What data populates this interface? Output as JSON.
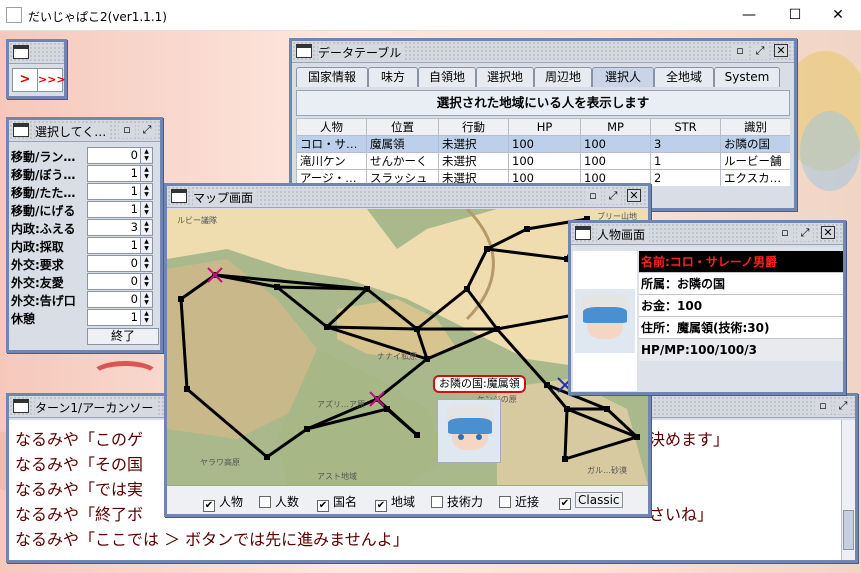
{
  "app": {
    "title": "だいじゃぱこ2(ver1.1.1)",
    "controls": {
      "minimize": "—",
      "maximize": "☐",
      "close": "✕"
    }
  },
  "launcher": {
    "arrow_label": ">>>"
  },
  "params": {
    "title": "選択してく…",
    "rows": [
      {
        "label": "移動/ラン…",
        "value": "0"
      },
      {
        "label": "移動/ぼう…",
        "value": "1"
      },
      {
        "label": "移動/たた…",
        "value": "1"
      },
      {
        "label": "移動/にげる",
        "value": "1"
      },
      {
        "label": "内政:ふえる",
        "value": "3"
      },
      {
        "label": "内政:採取",
        "value": "1"
      },
      {
        "label": "外交:要求",
        "value": "0"
      },
      {
        "label": "外交:友愛",
        "value": "0"
      },
      {
        "label": "外交:告げ口",
        "value": "0"
      },
      {
        "label": "休憩",
        "value": "1"
      }
    ],
    "end_button": "終了"
  },
  "data_table_window": {
    "title": "データテーブル",
    "tabs": [
      "国家情報",
      "味方",
      "自領地",
      "選択地",
      "周辺地",
      "選択人",
      "全地域",
      "System"
    ],
    "selected_tab": "選択人",
    "banner": "選択された地域にいる人を表示します",
    "columns": [
      "人物",
      "位置",
      "行動",
      "HP",
      "MP",
      "STR",
      "識別"
    ],
    "rows": [
      [
        "コロ・サ…",
        "魔属領",
        "未選択",
        "100",
        "100",
        "3",
        "お隣の国"
      ],
      [
        "滝川ケン",
        "せんかーく",
        "未選択",
        "100",
        "100",
        "1",
        "ルービー舗"
      ],
      [
        "アージ・…",
        "スラッシュ",
        "未選択",
        "100",
        "100",
        "2",
        "エクスカ…"
      ]
    ]
  },
  "map_window": {
    "title": "マップ画面",
    "region_labels": [
      "ルビー議隊",
      "ナナイ私原",
      "アズリ…ア原",
      "ヤラワ高原",
      "アスト地域",
      "ケンジの原",
      "ガル…砂漠",
      "ブリー山地"
    ],
    "popup_label": "お隣の国:魔属領",
    "checkboxes": [
      {
        "label": "人物",
        "checked": true
      },
      {
        "label": "人数",
        "checked": false
      },
      {
        "label": "国名",
        "checked": true
      },
      {
        "label": "地域",
        "checked": true
      },
      {
        "label": "技術力",
        "checked": false
      },
      {
        "label": "近接",
        "checked": false
      },
      {
        "label": "Classic",
        "checked": true
      }
    ]
  },
  "person_window": {
    "title": "人物画面",
    "name": "名前:コロ・サレーノ男爵",
    "affiliation": "所属：お隣の国",
    "money": "お金：100",
    "residence": "住所：魔属領(技術:30)",
    "hpmp": "HP/MP:100/100/3"
  },
  "log_window": {
    "title": "ターン1/アーカンソー",
    "lines": [
      "なるみや「このゲ",
      "なるみや「その国",
      "なるみや「では実",
      "なるみや「終了ボ",
      "なるみや「ここでは ＞ ボタンでは先に進みませんよ」"
    ],
    "right_fragments": [
      "決めます」",
      "さいね」"
    ]
  },
  "colors": {
    "frame": "#6f86b2",
    "name_bar": "#000000",
    "name_text": "#ff2020",
    "log_text": "#5a0000"
  }
}
